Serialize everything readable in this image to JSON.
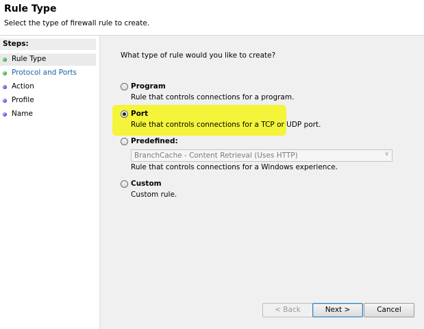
{
  "header": {
    "title": "Rule Type",
    "subtitle": "Select the type of firewall rule to create."
  },
  "steps": {
    "title": "Steps:",
    "items": [
      {
        "label": "Rule Type",
        "status": "completed",
        "dot_color": "#2fa32f"
      },
      {
        "label": "Protocol and Ports",
        "status": "link",
        "dot_color": "#2fa32f"
      },
      {
        "label": "Action",
        "status": "pending",
        "dot_color": "#4a47c9"
      },
      {
        "label": "Profile",
        "status": "pending",
        "dot_color": "#4a47c9"
      },
      {
        "label": "Name",
        "status": "pending",
        "dot_color": "#4a47c9"
      }
    ]
  },
  "main": {
    "question": "What type of rule would you like to create?",
    "options": [
      {
        "label": "Program",
        "description": "Rule that controls connections for a program.",
        "selected": false
      },
      {
        "label": "Port",
        "description": "Rule that controls connections for a TCP or UDP port.",
        "selected": true
      },
      {
        "label": "Predefined:",
        "description": "Rule that controls connections for a Windows experience.",
        "selected": false
      },
      {
        "label": "Custom",
        "description": "Custom rule.",
        "selected": false
      }
    ],
    "predefined_select_value": "BranchCache - Content Retrieval (Uses HTTP)",
    "highlight_color": "#f4f43a"
  },
  "buttons": {
    "back": "< Back",
    "next": "Next >",
    "cancel": "Cancel"
  }
}
